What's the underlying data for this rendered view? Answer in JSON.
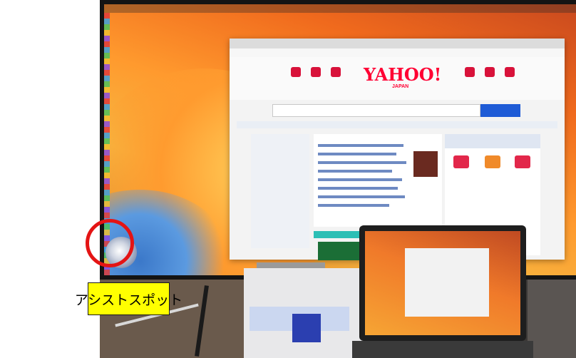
{
  "callout": {
    "label": "アシストスポット"
  },
  "browser": {
    "logo_text": "YAHOO!",
    "logo_sub": "JAPAN"
  },
  "colors": {
    "highlight": "#e41414",
    "callout_bg": "#ffff00",
    "yahoo_red": "#ff0033"
  },
  "icons": {
    "assist": "assistive-touch-icon"
  }
}
